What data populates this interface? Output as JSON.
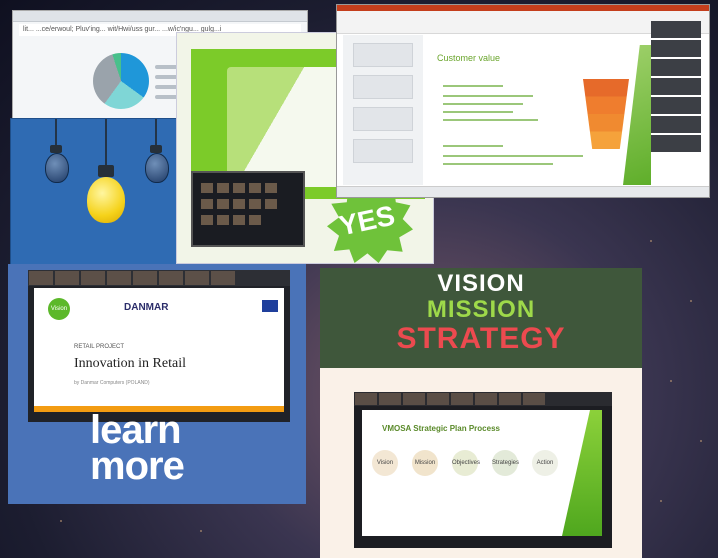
{
  "collage": {
    "tile_browser": {
      "url_text": "lit... ...ce/erwoul; Pluv'ing... wit/Hwi/uss gur... ...w/ic'ngu... gulg...i",
      "pie_colors": [
        "#1f97d9",
        "#7fd6d6",
        "#9aa3ab",
        "#48c08b"
      ]
    },
    "tile_bulbs": {
      "colors": {
        "background": "#2f6bb3",
        "lit_bulb": "#f5d21a"
      }
    },
    "tile_retail": {
      "slide_title": "RETAIL PROJECT",
      "badge_text": "YES",
      "accent": "#7ccb29"
    },
    "tile_customer_value": {
      "slide_title": "Customer value",
      "accent": "#6aa52c"
    },
    "tile_innovation": {
      "logo_text": "Vision",
      "partner_logo": "DANMAR",
      "kicker": "RETAIL PROJECT",
      "title": "Innovation in Retail",
      "subline": "by Danmar Computers (POLAND)",
      "banner_word_1": "learn",
      "banner_word_2": "more"
    },
    "tile_vmosa": {
      "line_1": "VISION",
      "line_2": "MISSION",
      "line_3": "STRATEGY",
      "slide_title": "VMOSA Strategic Plan Process",
      "steps": [
        "Vision",
        "Mission",
        "Objectives",
        "Strategies",
        "Action"
      ],
      "colors": {
        "vision": "#ffffff",
        "mission": "#9ed94a",
        "strategy": "#ec4a4f",
        "header": "#3f573b"
      }
    }
  }
}
